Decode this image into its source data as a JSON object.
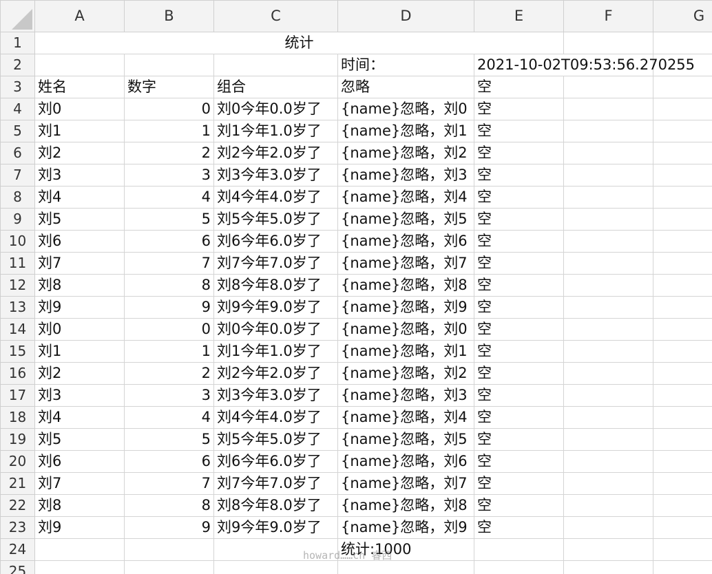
{
  "columns": [
    "A",
    "B",
    "C",
    "D",
    "E",
    "F",
    "G"
  ],
  "title": "统计",
  "time_label": "时间：",
  "time_value": "2021-10-02T09:53:56.270255",
  "headers": {
    "name": "姓名",
    "number": "数字",
    "combo": "组合",
    "ignore": "忽略",
    "empty": "空"
  },
  "rows": [
    {
      "name": "刘0",
      "number": "0",
      "combo": "刘0今年0.0岁了",
      "ignore": "{name}忽略，刘0",
      "empty": "空"
    },
    {
      "name": "刘1",
      "number": "1",
      "combo": "刘1今年1.0岁了",
      "ignore": "{name}忽略，刘1",
      "empty": "空"
    },
    {
      "name": "刘2",
      "number": "2",
      "combo": "刘2今年2.0岁了",
      "ignore": "{name}忽略，刘2",
      "empty": "空"
    },
    {
      "name": "刘3",
      "number": "3",
      "combo": "刘3今年3.0岁了",
      "ignore": "{name}忽略，刘3",
      "empty": "空"
    },
    {
      "name": "刘4",
      "number": "4",
      "combo": "刘4今年4.0岁了",
      "ignore": "{name}忽略，刘4",
      "empty": "空"
    },
    {
      "name": "刘5",
      "number": "5",
      "combo": "刘5今年5.0岁了",
      "ignore": "{name}忽略，刘5",
      "empty": "空"
    },
    {
      "name": "刘6",
      "number": "6",
      "combo": "刘6今年6.0岁了",
      "ignore": "{name}忽略，刘6",
      "empty": "空"
    },
    {
      "name": "刘7",
      "number": "7",
      "combo": "刘7今年7.0岁了",
      "ignore": "{name}忽略，刘7",
      "empty": "空"
    },
    {
      "name": "刘8",
      "number": "8",
      "combo": "刘8今年8.0岁了",
      "ignore": "{name}忽略，刘8",
      "empty": "空"
    },
    {
      "name": "刘9",
      "number": "9",
      "combo": "刘9今年9.0岁了",
      "ignore": "{name}忽略，刘9",
      "empty": "空"
    },
    {
      "name": "刘0",
      "number": "0",
      "combo": "刘0今年0.0岁了",
      "ignore": "{name}忽略，刘0",
      "empty": "空"
    },
    {
      "name": "刘1",
      "number": "1",
      "combo": "刘1今年1.0岁了",
      "ignore": "{name}忽略，刘1",
      "empty": "空"
    },
    {
      "name": "刘2",
      "number": "2",
      "combo": "刘2今年2.0岁了",
      "ignore": "{name}忽略，刘2",
      "empty": "空"
    },
    {
      "name": "刘3",
      "number": "3",
      "combo": "刘3今年3.0岁了",
      "ignore": "{name}忽略，刘3",
      "empty": "空"
    },
    {
      "name": "刘4",
      "number": "4",
      "combo": "刘4今年4.0岁了",
      "ignore": "{name}忽略，刘4",
      "empty": "空"
    },
    {
      "name": "刘5",
      "number": "5",
      "combo": "刘5今年5.0岁了",
      "ignore": "{name}忽略，刘5",
      "empty": "空"
    },
    {
      "name": "刘6",
      "number": "6",
      "combo": "刘6今年6.0岁了",
      "ignore": "{name}忽略，刘6",
      "empty": "空"
    },
    {
      "name": "刘7",
      "number": "7",
      "combo": "刘7今年7.0岁了",
      "ignore": "{name}忽略，刘7",
      "empty": "空"
    },
    {
      "name": "刘8",
      "number": "8",
      "combo": "刘8今年8.0岁了",
      "ignore": "{name}忽略，刘8",
      "empty": "空"
    },
    {
      "name": "刘9",
      "number": "9",
      "combo": "刘9今年9.0岁了",
      "ignore": "{name}忽略，刘9",
      "empty": "空"
    }
  ],
  "summary": "统计:1000",
  "watermark": "howard……cn 睿西",
  "row_numbers": [
    "1",
    "2",
    "3",
    "4",
    "5",
    "6",
    "7",
    "8",
    "9",
    "10",
    "11",
    "12",
    "13",
    "14",
    "15",
    "16",
    "17",
    "18",
    "19",
    "20",
    "21",
    "22",
    "23",
    "24",
    "25"
  ]
}
